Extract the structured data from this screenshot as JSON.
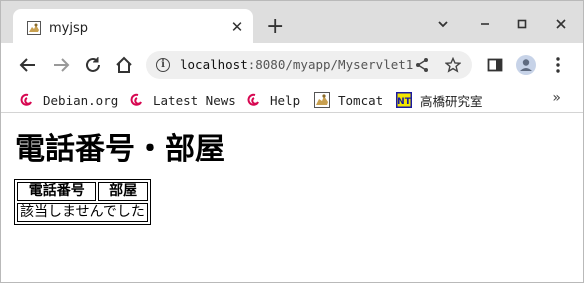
{
  "tab": {
    "title": "myjsp",
    "close_glyph": "✕"
  },
  "new_tab_glyph": "+",
  "window_controls": {
    "menu": "⌄",
    "minimize": "−",
    "maximize": "□",
    "close": "✕"
  },
  "omnibox": {
    "host": "localhost",
    "path": ":8080/myapp/Myservlet1"
  },
  "bookmarks": [
    {
      "label": "Debian.org",
      "icon": "debian-icon"
    },
    {
      "label": "Latest News",
      "icon": "debian-icon"
    },
    {
      "label": "Help",
      "icon": "debian-icon"
    },
    {
      "label": "Tomcat",
      "icon": "tomcat-icon"
    },
    {
      "label": "高橋研究室",
      "icon": "nt-icon"
    }
  ],
  "bookmarks_more": "»",
  "content": {
    "heading": "電話番号・部屋",
    "table": {
      "headers": [
        "電話番号",
        "部屋"
      ],
      "message": "該当しませんでした"
    }
  },
  "colors": {
    "tab_strip": "#dedede",
    "omnibox_bg": "#efefef",
    "debian_red": "#d70751"
  }
}
